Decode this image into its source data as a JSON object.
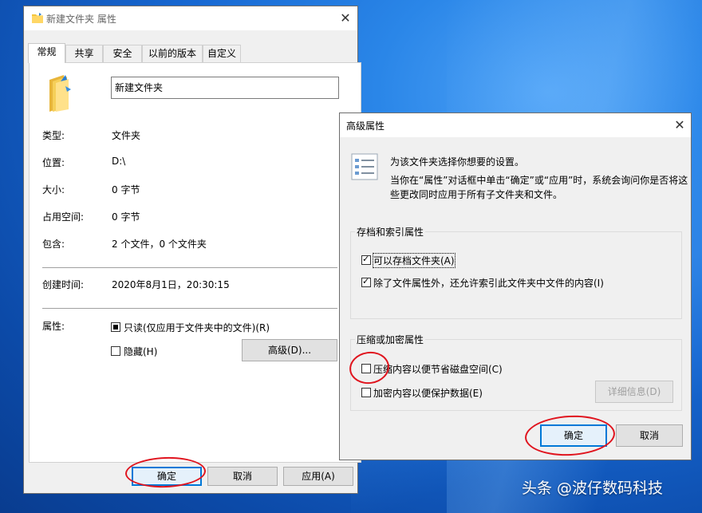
{
  "props_window": {
    "title": "新建文件夹 属性",
    "tabs": [
      "常规",
      "共享",
      "安全",
      "以前的版本",
      "自定义"
    ],
    "folder_name": "新建文件夹",
    "rows": [
      {
        "label": "类型:",
        "value": "文件夹"
      },
      {
        "label": "位置:",
        "value": "D:\\"
      },
      {
        "label": "大小:",
        "value": "0 字节"
      },
      {
        "label": "占用空间:",
        "value": "0 字节"
      },
      {
        "label": "包含:",
        "value": "2 个文件，0 个文件夹"
      }
    ],
    "created_label": "创建时间:",
    "created_value": "2020年8月1日，20:30:15",
    "attrs_label": "属性:",
    "readonly_label": "只读(仅应用于文件夹中的文件)(R)",
    "hidden_label": "隐藏(H)",
    "advanced_button": "高级(D)...",
    "ok": "确定",
    "cancel": "取消",
    "apply": "应用(A)"
  },
  "adv_window": {
    "title": "高级属性",
    "desc1": "为该文件夹选择你想要的设置。",
    "desc2": "当你在“属性”对话框中单击“确定”或“应用”时，系统会询问你是否将这",
    "desc3": "些更改同时应用于所有子文件夹和文件。",
    "archive_group": "存档和索引属性",
    "archive_label": "可以存档文件夹(A)",
    "index_label": "除了文件属性外，还允许索引此文件夹中文件的内容(I)",
    "compress_group": "压缩或加密属性",
    "compress_label": "压缩内容以便节省磁盘空间(C)",
    "encrypt_label": "加密内容以便保护数据(E)",
    "details_button": "详细信息(D)",
    "ok": "确定",
    "cancel": "取消"
  },
  "watermark": "头条 @波仔数码科技",
  "colors": {
    "annotation_red": "#e0141e",
    "accent": "#0078d7"
  }
}
